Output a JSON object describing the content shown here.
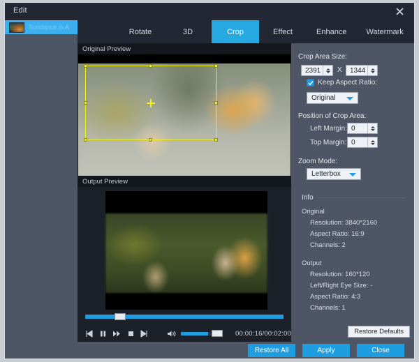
{
  "window": {
    "title": "Edit",
    "close_icon": "close-icon"
  },
  "tabs": [
    {
      "label": "Rotate",
      "active": false
    },
    {
      "label": "3D",
      "active": false
    },
    {
      "label": "Crop",
      "active": true
    },
    {
      "label": "Effect",
      "active": false
    },
    {
      "label": "Enhance",
      "active": false
    },
    {
      "label": "Watermark",
      "active": false
    }
  ],
  "sidebar": {
    "items": [
      {
        "label": "Sundance in A",
        "selected": true
      }
    ]
  },
  "previews": {
    "original_title": "Original Preview",
    "output_title": "Output Preview"
  },
  "player": {
    "prev_icon": "skip-previous-icon",
    "pause_icon": "pause-icon",
    "forward_icon": "fast-forward-icon",
    "stop_icon": "stop-icon",
    "next_icon": "skip-next-icon",
    "volume_icon": "volume-icon",
    "time": "00:00:16/00:02:00",
    "seek_percent": 15,
    "volume_percent": 70
  },
  "right_panel": {
    "crop_area_size_label": "Crop Area Size:",
    "width_value": "2391",
    "height_value": "1344",
    "size_separator": "X",
    "keep_aspect_label": "Keep Aspect Ratio:",
    "keep_aspect_checked": true,
    "aspect_ratio_value": "Original",
    "position_label": "Position of Crop Area:",
    "left_margin_label": "Left Margin:",
    "left_margin_value": "0",
    "top_margin_label": "Top Margin:",
    "top_margin_value": "0",
    "zoom_mode_label": "Zoom Mode:",
    "zoom_mode_value": "Letterbox",
    "info_title": "Info",
    "original_heading": "Original",
    "original_rows": [
      "Resolution: 3840*2160",
      "Aspect Ratio: 16:9",
      "Channels: 2"
    ],
    "output_heading": "Output",
    "output_rows": [
      "Resolution: 160*120",
      "Left/Right Eye Size: -",
      "Aspect Ratio: 4:3",
      "Channels: 1"
    ],
    "restore_defaults_label": "Restore Defaults"
  },
  "footer": {
    "restore_all_label": "Restore All",
    "apply_label": "Apply",
    "close_label": "Close"
  },
  "colors": {
    "accent": "#1e9ee0",
    "tab_active": "#26a9e0",
    "panel": "#4e5666",
    "titlebar": "#222733",
    "crop_outline": "#f2ef18"
  }
}
